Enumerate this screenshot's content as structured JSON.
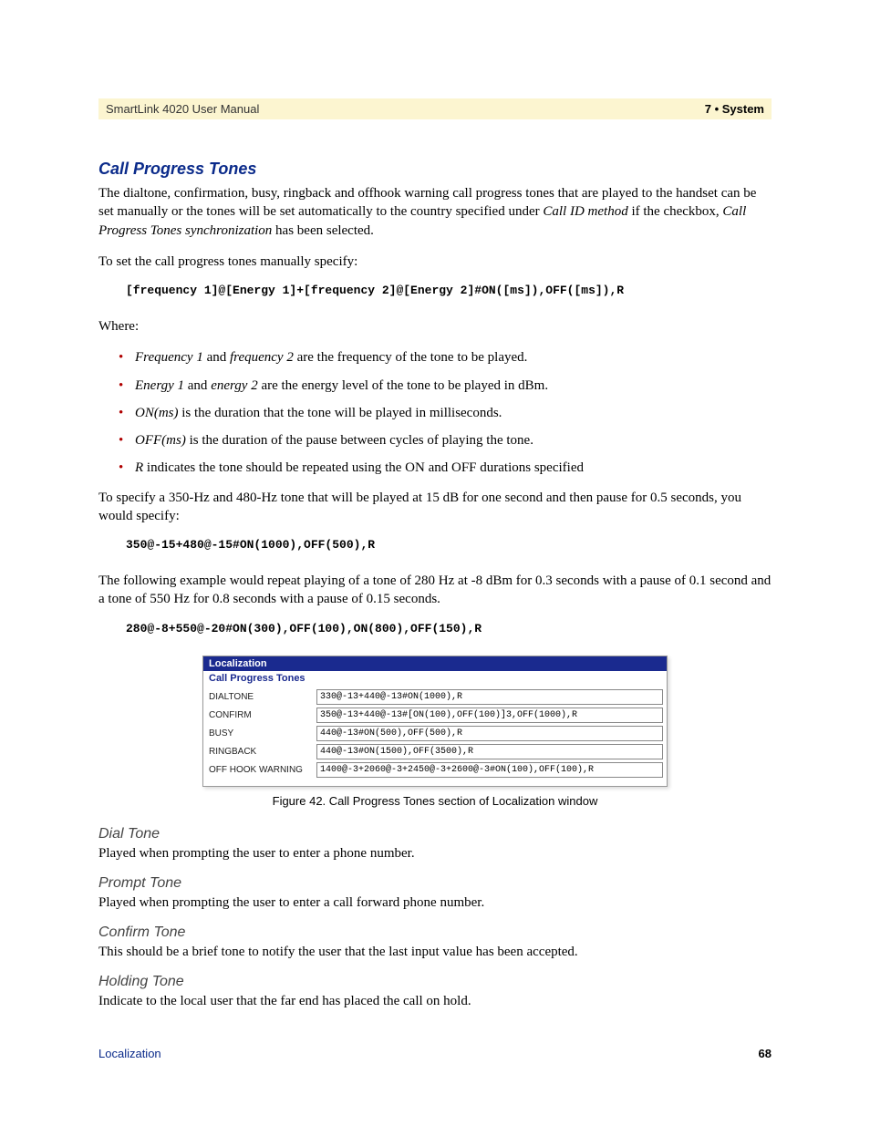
{
  "header": {
    "manual_title": "SmartLink 4020 User Manual",
    "chapter": "7 • System"
  },
  "h1": "Call Progress Tones",
  "intro_parts": {
    "a": "The dialtone, confirmation, busy, ringback and offhook warning call progress tones that are played to the handset can be set manually or the tones will be set automatically to the country specified under ",
    "b": "Call ID method",
    "c": " if the checkbox, ",
    "d": "Call Progress Tones synchronization",
    "e": " has been selected."
  },
  "p_instr": "To set the call progress tones manually specify:",
  "code1": "[frequency 1]@[Energy 1]+[frequency 2]@[Energy 2]#ON([ms]),OFF([ms]),R",
  "where": "Where:",
  "bullets": [
    {
      "i": "Frequency 1",
      "m": " and ",
      "i2": "frequency 2",
      "t": " are the frequency of the tone to be played."
    },
    {
      "i": "Energy 1",
      "m": " and ",
      "i2": "energy 2",
      "t": " are the energy level of the tone to be played in dBm."
    },
    {
      "i": "ON(ms)",
      "t": " is the duration that the tone will be played in milliseconds."
    },
    {
      "i": "OFF(ms)",
      "t": " is the duration of the pause between cycles of playing the tone."
    },
    {
      "i": "R",
      "t": " indicates the tone should be repeated using the ON and OFF durations specified"
    }
  ],
  "p_example1": "To specify a 350-Hz and 480-Hz tone that will be played at 15 dB for one second and then pause for 0.5 seconds, you would specify:",
  "code2": "350@-15+480@-15#ON(1000),OFF(500),R",
  "p_example2": "The following example would repeat playing of a tone of 280 Hz at -8 dBm for 0.3 seconds with a pause of 0.1 second and a tone of 550 Hz for 0.8 seconds with a pause of 0.15 seconds.",
  "code3": "280@-8+550@-20#ON(300),OFF(100),ON(800),OFF(150),R",
  "figure": {
    "titlebar": "Localization",
    "subtitle": "Call Progress Tones",
    "rows": [
      {
        "label": "DIALTONE",
        "value": "330@-13+440@-13#ON(1000),R"
      },
      {
        "label": "CONFIRM",
        "value": "350@-13+440@-13#[ON(100),OFF(100)]3,OFF(1000),R"
      },
      {
        "label": "BUSY",
        "value": "440@-13#ON(500),OFF(500),R"
      },
      {
        "label": "RINGBACK",
        "value": "440@-13#ON(1500),OFF(3500),R"
      },
      {
        "label": "OFF HOOK WARNING",
        "value": "1400@-3+2060@-3+2450@-3+2600@-3#ON(100),OFF(100),R"
      }
    ],
    "caption": "Figure 42. Call Progress Tones section of Localization window"
  },
  "subs": [
    {
      "h": "Dial Tone",
      "p": "Played when prompting the user to enter a phone number."
    },
    {
      "h": "Prompt Tone",
      "p": "Played when prompting the user to enter a call forward phone number."
    },
    {
      "h": "Confirm Tone",
      "p": "This should be a brief tone to notify the user that the last input value has been accepted."
    },
    {
      "h": "Holding Tone",
      "p": "Indicate to the local user that the far end has placed the call on hold."
    }
  ],
  "footer": {
    "left": "Localization",
    "right": "68"
  }
}
